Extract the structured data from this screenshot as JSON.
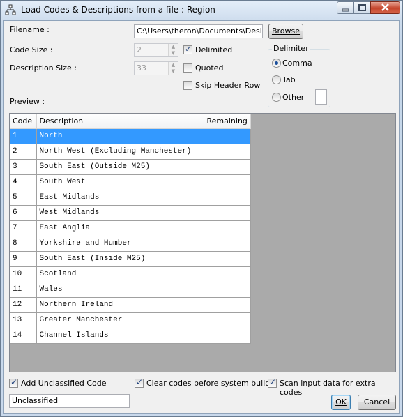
{
  "window": {
    "title": "Load Codes & Descriptions from a file : Region"
  },
  "form": {
    "filename_label": "Filename :",
    "filename_value": "C:\\Users\\theron\\Documents\\Designe",
    "browse_label": "Browse",
    "code_size_label": "Code Size :",
    "code_size_value": "2",
    "description_size_label": "Description Size :",
    "description_size_value": "33",
    "delimited_label": "Delimited",
    "delimited_checked": true,
    "quoted_label": "Quoted",
    "quoted_checked": false,
    "skip_header_label": "Skip Header Row",
    "skip_header_checked": false,
    "preview_label": "Preview :"
  },
  "delimiter": {
    "title": "Delimiter",
    "comma_label": "Comma",
    "tab_label": "Tab",
    "other_label": "Other",
    "selected": "Comma",
    "other_value": ""
  },
  "preview_table": {
    "headers": [
      "Code",
      "Description",
      "Remaining"
    ],
    "selected_row": 0,
    "rows": [
      {
        "code": "1",
        "description": "North",
        "remaining": ""
      },
      {
        "code": "2",
        "description": "North West (Excluding Manchester)",
        "remaining": ""
      },
      {
        "code": "3",
        "description": "South East (Outside M25)",
        "remaining": ""
      },
      {
        "code": "4",
        "description": "South West",
        "remaining": ""
      },
      {
        "code": "5",
        "description": "East Midlands",
        "remaining": ""
      },
      {
        "code": "6",
        "description": "West Midlands",
        "remaining": ""
      },
      {
        "code": "7",
        "description": "East Anglia",
        "remaining": ""
      },
      {
        "code": "8",
        "description": "Yorkshire and Humber",
        "remaining": ""
      },
      {
        "code": "9",
        "description": "South East (Inside M25)",
        "remaining": ""
      },
      {
        "code": "10",
        "description": "Scotland",
        "remaining": ""
      },
      {
        "code": "11",
        "description": "Wales",
        "remaining": ""
      },
      {
        "code": "12",
        "description": "Northern Ireland",
        "remaining": ""
      },
      {
        "code": "13",
        "description": "Greater Manchester",
        "remaining": ""
      },
      {
        "code": "14",
        "description": "Channel Islands",
        "remaining": ""
      }
    ]
  },
  "options": {
    "add_unclassified_label": "Add Unclassified Code",
    "add_unclassified_checked": true,
    "clear_codes_label": "Clear codes before system build",
    "clear_codes_checked": true,
    "scan_input_label": "Scan input data for extra codes",
    "scan_input_checked": true,
    "unclassified_value": "Unclassified"
  },
  "buttons": {
    "ok_label": "OK",
    "cancel_label": "Cancel"
  }
}
